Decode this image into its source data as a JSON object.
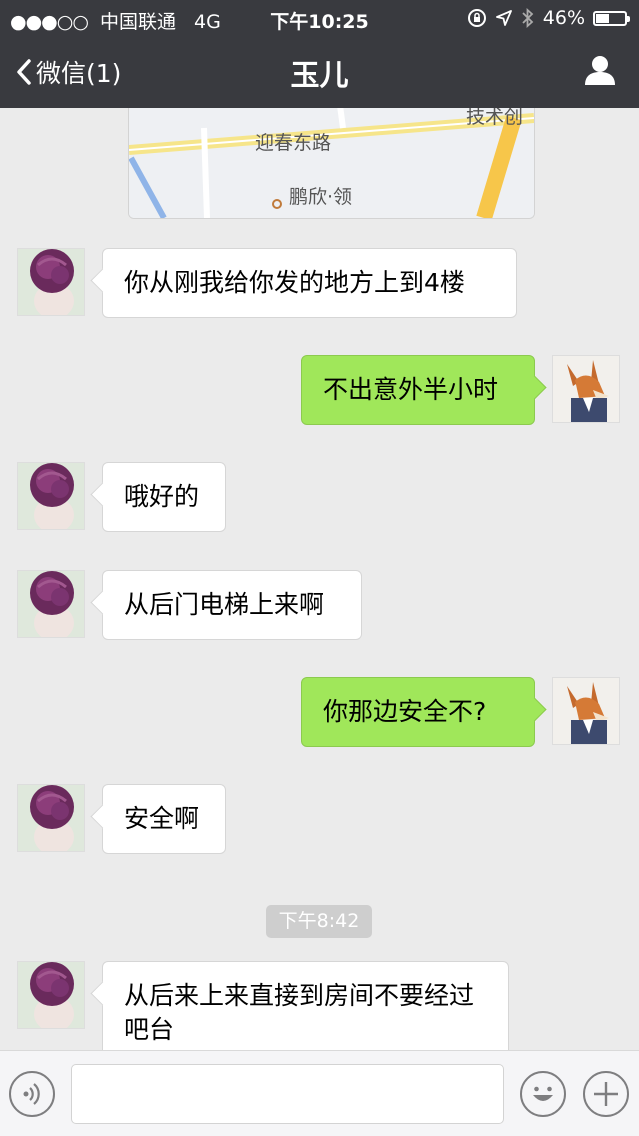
{
  "status_bar": {
    "carrier": "中国联通",
    "network": "4G",
    "time": "下午10:25",
    "battery_percent": "46%",
    "battery_level": 0.46
  },
  "nav": {
    "back_label": "微信(1)",
    "title": "玉儿"
  },
  "map_preview": {
    "labels": [
      "迎春东路",
      "技术创",
      "鹏欣·领"
    ]
  },
  "messages": [
    {
      "side": "in",
      "text": "你从刚我给你发的地方上到4楼"
    },
    {
      "side": "out",
      "text": "不出意外半小时"
    },
    {
      "side": "in",
      "text": "哦好的"
    },
    {
      "side": "in",
      "text": "从后门电梯上来啊"
    },
    {
      "side": "out",
      "text": "你那边安全不?"
    },
    {
      "side": "in",
      "text": "安全啊"
    },
    {
      "side": "in",
      "text": "从后来上来直接到房间不要经过吧台"
    }
  ],
  "timestamp": "下午8:42",
  "input": {
    "value": "",
    "placeholder": ""
  },
  "icons": [
    "back-chevron-icon",
    "profile-icon",
    "voice-icon",
    "emoji-icon",
    "plus-icon"
  ],
  "colors": {
    "header_bg": "#393a3f",
    "chat_bg": "#ebebeb",
    "outgoing_bubble": "#a0e75a",
    "incoming_bubble": "#ffffff"
  }
}
